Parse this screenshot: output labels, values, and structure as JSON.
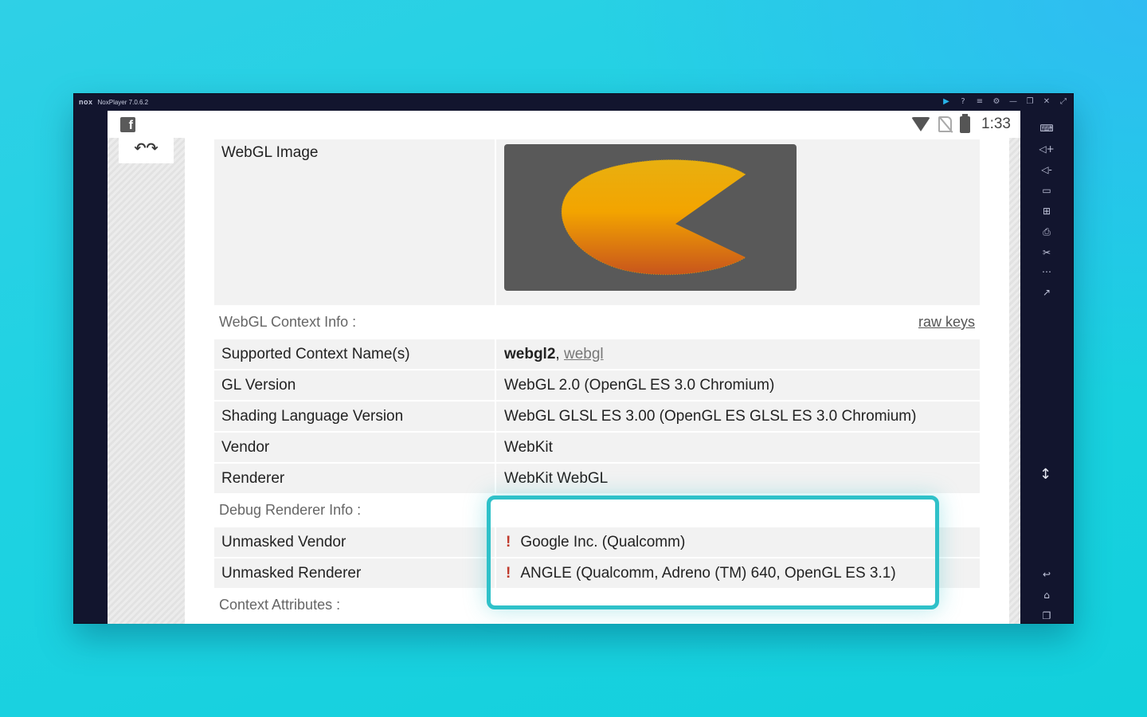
{
  "emulator": {
    "logo": "nox",
    "title": "NoxPlayer 7.0.6.2"
  },
  "status_bar": {
    "time": "1:33"
  },
  "webgl_image": {
    "label": "WebGL Image"
  },
  "context_info": {
    "section_title": "WebGL Context Info :",
    "raw_keys_link": "raw keys",
    "rows": [
      {
        "key": "Supported Context Name(s)",
        "value_bold": "webgl2",
        "value_sep": ", ",
        "value_link": "webgl"
      },
      {
        "key": "GL Version",
        "value": "WebGL 2.0 (OpenGL ES 3.0 Chromium)"
      },
      {
        "key": "Shading Language Version",
        "value": "WebGL GLSL ES 3.00 (OpenGL ES GLSL ES 3.0 Chromium)"
      },
      {
        "key": "Vendor",
        "value": "WebKit"
      },
      {
        "key": "Renderer",
        "value": "WebKit WebGL"
      }
    ]
  },
  "debug_info": {
    "section_title": "Debug Renderer Info :",
    "warning_mark": "!",
    "rows": [
      {
        "key": "Unmasked Vendor",
        "value": "Google Inc. (Qualcomm)"
      },
      {
        "key": "Unmasked Renderer",
        "value": "ANGLE (Qualcomm, Adreno (TM) 640, OpenGL ES 3.1)"
      }
    ]
  },
  "context_attributes": {
    "section_title": "Context Attributes :"
  },
  "colors": {
    "highlight": "#2fc1c9",
    "warning": "#c0392b",
    "background": "#1fd2e2"
  },
  "icons": [
    "facebook-icon",
    "wifi-icon",
    "no-sim-icon",
    "battery-icon",
    "play-icon",
    "help-icon",
    "menu-icon",
    "settings-icon",
    "minimize-icon",
    "restore-icon",
    "close-icon",
    "fullscreen-icon",
    "keyboard-icon",
    "volume-up-icon",
    "volume-down-icon",
    "screen-icon",
    "install-apk-icon",
    "screenshot-icon",
    "scissors-icon",
    "more-icon",
    "multi-window-icon",
    "back-icon",
    "home-icon",
    "recents-icon"
  ]
}
